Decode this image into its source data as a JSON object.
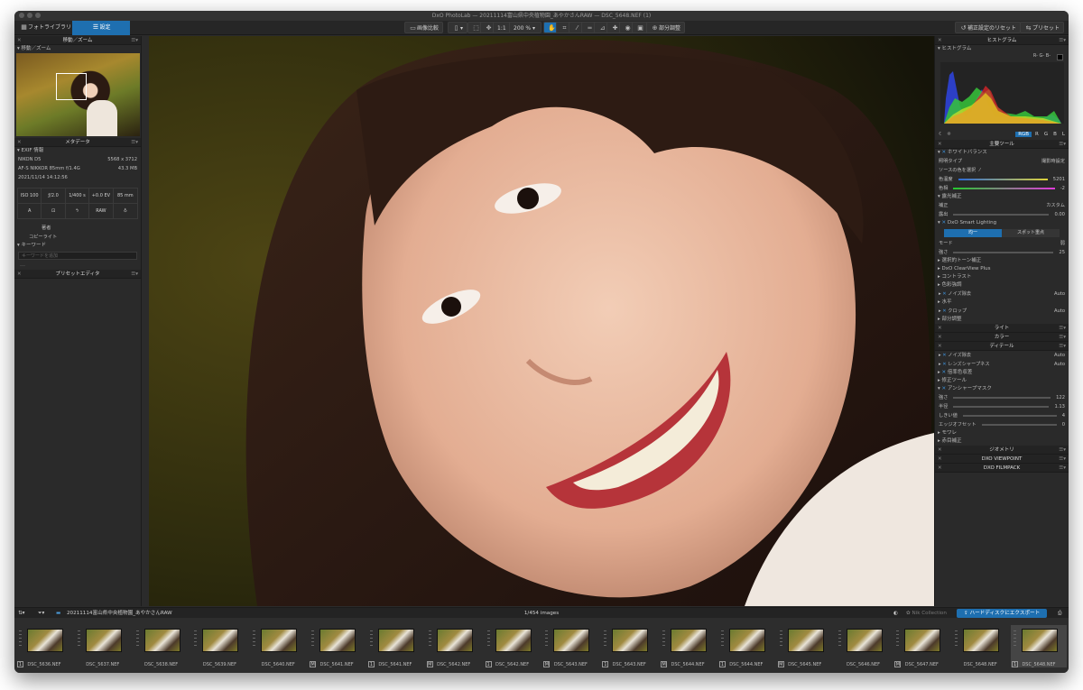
{
  "window_title": "DxO PhotoLab — 20211114富山県中央植物園_あやかさんRAW — DSC_5648.NEF (1)",
  "toolbar": {
    "tab_library": "フォトライブラリ",
    "tab_customize": "設定",
    "compare": "画像比較",
    "one_to_one": "1:1",
    "zoom": "200 %",
    "local_adjust": "部分調整",
    "reset": "補正設定のリセット",
    "presets": "プリセット"
  },
  "left": {
    "nav_title": "移動／ズーム",
    "nav_sub": "移動／ズーム",
    "meta_title": "メタデータ",
    "exif_title": "EXIF 情報",
    "camera": "NIKON D5",
    "dimensions": "5568 x 3712",
    "lens": "AF-S NIKKOR 85mm f/1.4G",
    "filesize": "43.3 MB",
    "datetime": "2021/11/14 14:12:56",
    "iso": "ISO 100",
    "aperture": "ƒ/2.0",
    "shutter": "1/400 s",
    "ev": "+0.0 EV",
    "focal": "85 mm",
    "mode": "A",
    "raw": "RAW",
    "author": "著者",
    "copyright": "コピーライト",
    "keywords": "キーワード",
    "keyword_placeholder": "キーワードを追加",
    "preset_editor": "プリセットエディタ"
  },
  "right": {
    "histogram": "ヒストグラム",
    "hist_sub": "ヒストグラム",
    "rgb_readout": "R- G- B-",
    "channels": [
      "RGB",
      "R",
      "G",
      "B",
      "L"
    ],
    "main_tools": "主要ツール",
    "wb": "ホワイトバランス",
    "wb_type_label": "照明タイプ",
    "wb_type_value": "撮影時設定",
    "picker_label": "ソースの色を選択",
    "temp_label": "色温度",
    "temp_value": "5201",
    "tint_label": "色相",
    "tint_value": "-2",
    "exposure": "露光補正",
    "exp_mode_label": "補正",
    "exp_mode_value": "カスタム",
    "exp_amount_label": "露出",
    "exp_amount_value": "0.00",
    "smart_lighting": "DxO Smart Lighting",
    "sl_uniform": "均一",
    "sl_spot": "スポット重点",
    "sl_mode_label": "モード",
    "sl_mode_value": "弱",
    "sl_strength_label": "強さ",
    "sl_strength_value": "25",
    "tone": "選択的トーン補正",
    "clearview": "DxO ClearView Plus",
    "contrast": "コントラスト",
    "color_accent": "色彩強調",
    "noise": "ノイズ除去",
    "noise_value": "Auto",
    "horizon": "水平",
    "crop": "クロップ",
    "crop_value": "Auto",
    "local": "部分調整",
    "light": "ライト",
    "color": "カラー",
    "detail": "ディテール",
    "d_noise": "ノイズ除去",
    "d_noise_value": "Auto",
    "lens_sharp": "レンズシャープネス",
    "lens_sharp_value": "Auto",
    "chroma": "倍率色収差",
    "repair": "修正ツール",
    "unsharp": "アンシャープマスク",
    "us_strength_label": "強さ",
    "us_strength_value": "122",
    "us_radius_label": "半径",
    "us_radius_value": "1.13",
    "us_threshold_label": "しきい値",
    "us_threshold_value": "4",
    "us_edge_label": "エッジオフセット",
    "us_edge_value": "0",
    "moire": "モワレ",
    "red_eye": "赤目補正",
    "geometry": "ジオメトリ",
    "viewpoint": "DXO VIEWPOINT",
    "filmpack": "DXO FILMPACK"
  },
  "filmhead": {
    "folder": "20211114富山県中央植物園_あやかさんRAW",
    "count": "1/454 images",
    "nik": "Nik Collection",
    "export": "ハードディスクにエクスポート"
  },
  "thumbs": [
    {
      "name": "DSC_5636.NEF",
      "badge": "1"
    },
    {
      "name": "DSC_5637.NEF",
      "badge": ""
    },
    {
      "name": "DSC_5638.NEF",
      "badge": ""
    },
    {
      "name": "DSC_5639.NEF",
      "badge": ""
    },
    {
      "name": "DSC_5640.NEF",
      "badge": ""
    },
    {
      "name": "DSC_5641.NEF",
      "badge": "M"
    },
    {
      "name": "DSC_5641.NEF",
      "badge": "1"
    },
    {
      "name": "DSC_5642.NEF",
      "badge": "M"
    },
    {
      "name": "DSC_5642.NEF",
      "badge": "1"
    },
    {
      "name": "DSC_5643.NEF",
      "badge": "M"
    },
    {
      "name": "DSC_5643.NEF",
      "badge": "1"
    },
    {
      "name": "DSC_5644.NEF",
      "badge": "M"
    },
    {
      "name": "DSC_5644.NEF",
      "badge": "1"
    },
    {
      "name": "DSC_5645.NEF",
      "badge": "M"
    },
    {
      "name": "DSC_5646.NEF",
      "badge": ""
    },
    {
      "name": "DSC_5647.NEF",
      "badge": "M"
    },
    {
      "name": "DSC_5648.NEF",
      "badge": ""
    },
    {
      "name": "DSC_5648.NEF",
      "badge": "1"
    }
  ]
}
